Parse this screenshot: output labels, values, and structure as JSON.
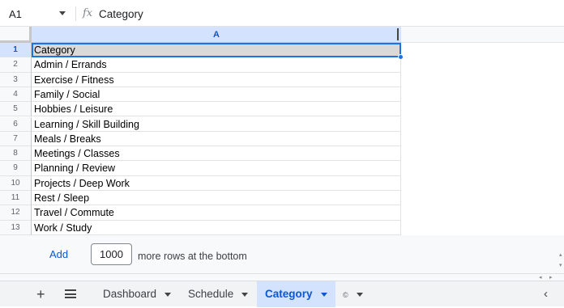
{
  "formula_bar": {
    "name_box": "A1",
    "fx_label": "fx",
    "content": "Category"
  },
  "grid": {
    "column_header": "A",
    "rows": [
      {
        "num": "1",
        "value": "Category"
      },
      {
        "num": "2",
        "value": "Admin / Errands"
      },
      {
        "num": "3",
        "value": "Exercise / Fitness"
      },
      {
        "num": "4",
        "value": "Family / Social"
      },
      {
        "num": "5",
        "value": "Hobbies / Leisure"
      },
      {
        "num": "6",
        "value": "Learning / Skill Building"
      },
      {
        "num": "7",
        "value": "Meals / Breaks"
      },
      {
        "num": "8",
        "value": "Meetings / Classes"
      },
      {
        "num": "9",
        "value": "Planning / Review"
      },
      {
        "num": "10",
        "value": "Projects / Deep Work"
      },
      {
        "num": "11",
        "value": "Rest / Sleep"
      },
      {
        "num": "12",
        "value": "Travel / Commute"
      },
      {
        "num": "13",
        "value": "Work / Study"
      }
    ]
  },
  "add_rows": {
    "add_label": "Add",
    "count": "1000",
    "suffix": "more rows at the bottom"
  },
  "tabs": {
    "add_icon": "+",
    "items": [
      {
        "label": "Dashboard",
        "active": false
      },
      {
        "label": "Schedule",
        "active": false
      },
      {
        "label": "Category",
        "active": true
      }
    ],
    "extra_tab_icon": "©",
    "collapse_icon": "‹"
  }
}
